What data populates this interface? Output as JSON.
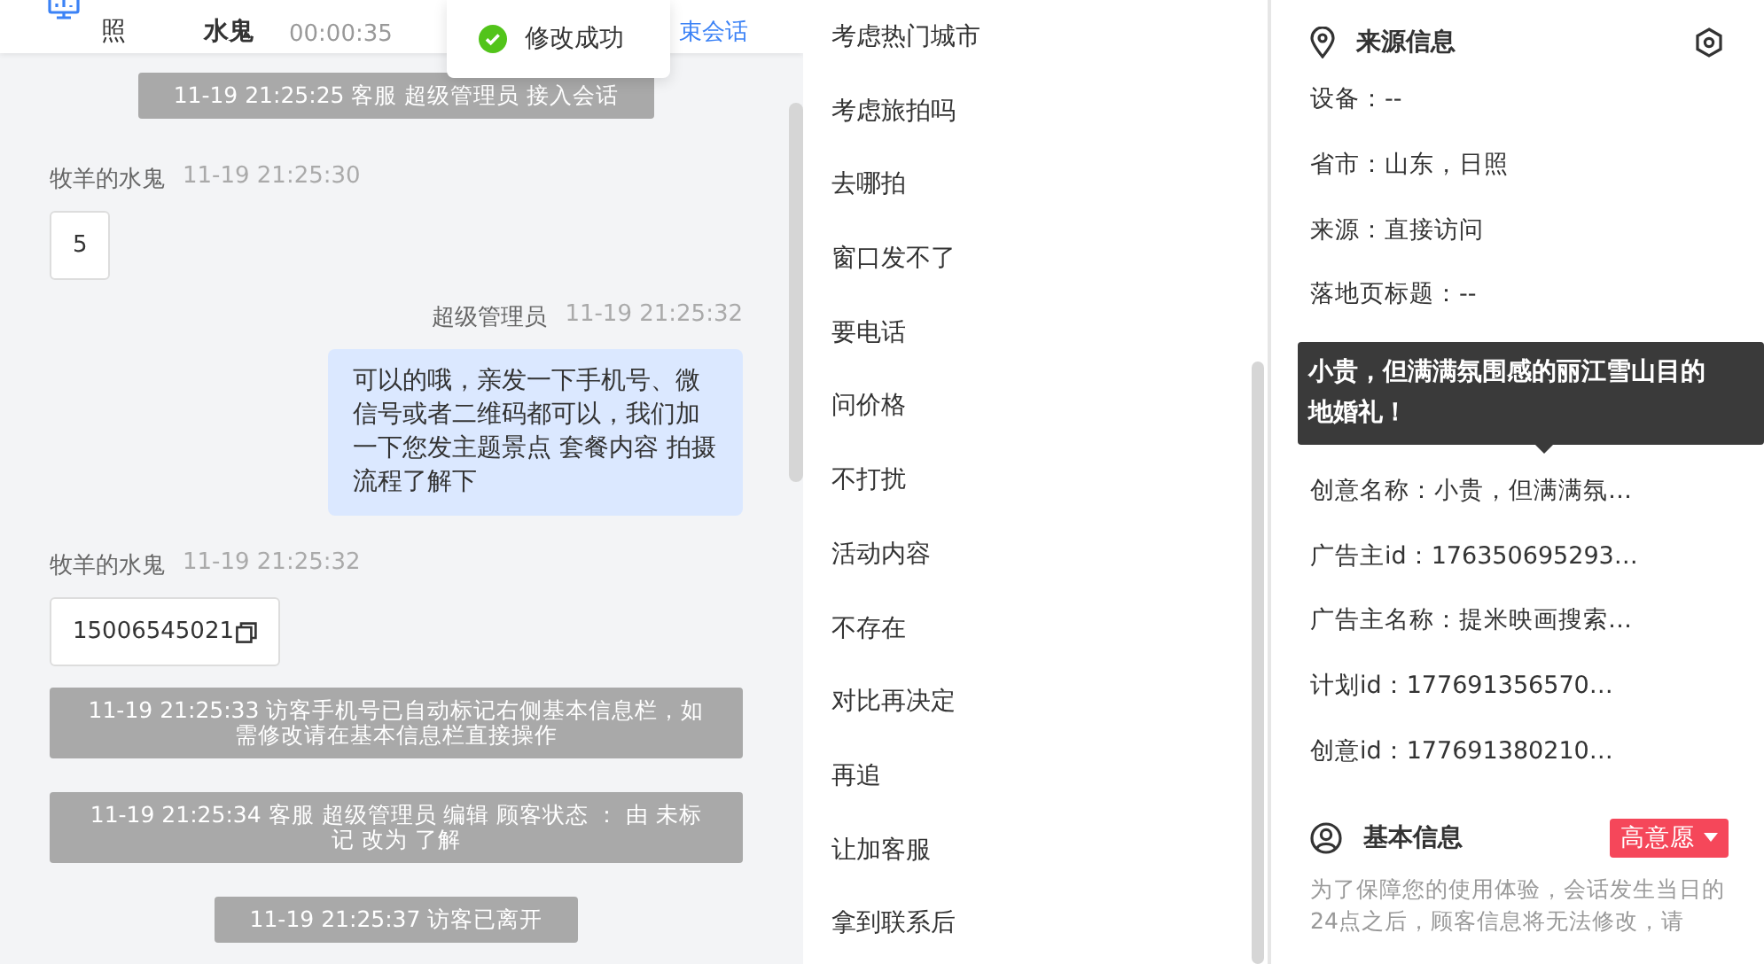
{
  "header": {
    "label_1": "照",
    "name": "水鬼",
    "timer": "00:00:35",
    "end_link": "束会话"
  },
  "toast": {
    "text": "修改成功"
  },
  "messages": [
    {
      "kind": "system",
      "text": "11-19 21:25:25 客服 超级管理员 接入会话"
    },
    {
      "kind": "visitor",
      "sender": "牧羊的水鬼",
      "time": "11-19 21:25:30",
      "text": "5",
      "copyable": false
    },
    {
      "kind": "agent",
      "sender": "超级管理员",
      "time": "11-19 21:25:32",
      "text": "可以的哦，亲发一下手机号、微信号或者二维码都可以，我们加一下您发主题景点 套餐内容 拍摄流程了解下"
    },
    {
      "kind": "visitor",
      "sender": "牧羊的水鬼",
      "time": "11-19 21:25:32",
      "text": "15006545021",
      "copyable": true
    },
    {
      "kind": "system",
      "text": "11-19 21:25:33 访客手机号已自动标记右侧基本信息栏，如需修改请在基本信息栏直接操作"
    },
    {
      "kind": "system",
      "text": "11-19 21:25:34 客服 超级管理员 编辑 顾客状态 ： 由 未标记 改为 了解"
    },
    {
      "kind": "system",
      "text": "11-19 21:25:37 访客已离开"
    }
  ],
  "quick_replies": [
    "考虑热门城市",
    "考虑旅拍吗",
    "去哪拍",
    "窗口发不了",
    "要电话",
    "问价格",
    "不打扰",
    "活动内容",
    "不存在",
    "对比再决定",
    "再追",
    "让加客服",
    "拿到联系后"
  ],
  "source_info": {
    "title": "来源信息",
    "items_above": [
      {
        "label": "设备：",
        "value": "--"
      },
      {
        "label": "省市：",
        "value": "山东，日照"
      },
      {
        "label": "来源：",
        "value": "直接访问"
      },
      {
        "label": "落地页标题：",
        "value": "--"
      }
    ],
    "tooltip": "小贵，但满满氛围感的丽江雪山目的地婚礼！",
    "items_below": [
      {
        "label": "创意名称：",
        "value": "小贵，但满满氛…"
      },
      {
        "label": "广告主id：",
        "value": "176350695293…"
      },
      {
        "label": "广告主名称：",
        "value": "提米映画搜索…"
      },
      {
        "label": "计划id：",
        "value": "177691356570…"
      },
      {
        "label": "创意id：",
        "value": "177691380210…"
      }
    ]
  },
  "basic_info": {
    "title": "基本信息",
    "intent_tag": "高意愿",
    "notice": "为了保障您的使用体验，会话发生当日的24点之后，顾客信息将无法修改，请"
  }
}
